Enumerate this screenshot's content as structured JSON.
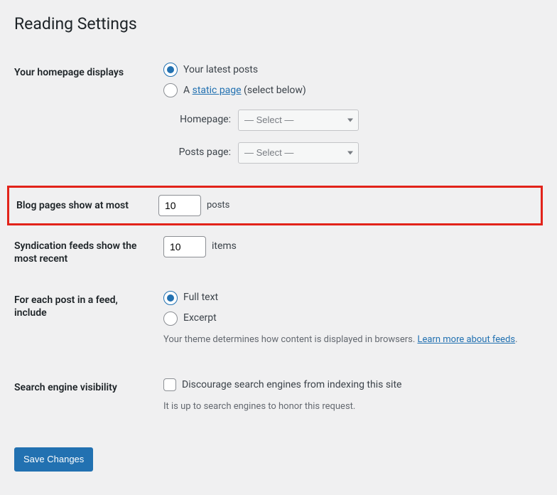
{
  "page": {
    "title": "Reading Settings"
  },
  "homepage": {
    "label": "Your homepage displays",
    "option_latest": "Your latest posts",
    "option_static_prefix": "A ",
    "option_static_link": "static page",
    "option_static_suffix": " (select below)",
    "homepage_label": "Homepage:",
    "posts_page_label": "Posts page:",
    "select_placeholder": "— Select —"
  },
  "blog_pages": {
    "label": "Blog pages show at most",
    "value": "10",
    "suffix": "posts"
  },
  "syndication": {
    "label": "Syndication feeds show the most recent",
    "value": "10",
    "suffix": "items"
  },
  "feed_content": {
    "label": "For each post in a feed, include",
    "option_full": "Full text",
    "option_excerpt": "Excerpt",
    "desc_prefix": "Your theme determines how content is displayed in browsers. ",
    "desc_link": "Learn more about feeds",
    "desc_suffix": "."
  },
  "search_visibility": {
    "label": "Search engine visibility",
    "checkbox_label": "Discourage search engines from indexing this site",
    "desc": "It is up to search engines to honor this request."
  },
  "submit": {
    "save": "Save Changes"
  }
}
